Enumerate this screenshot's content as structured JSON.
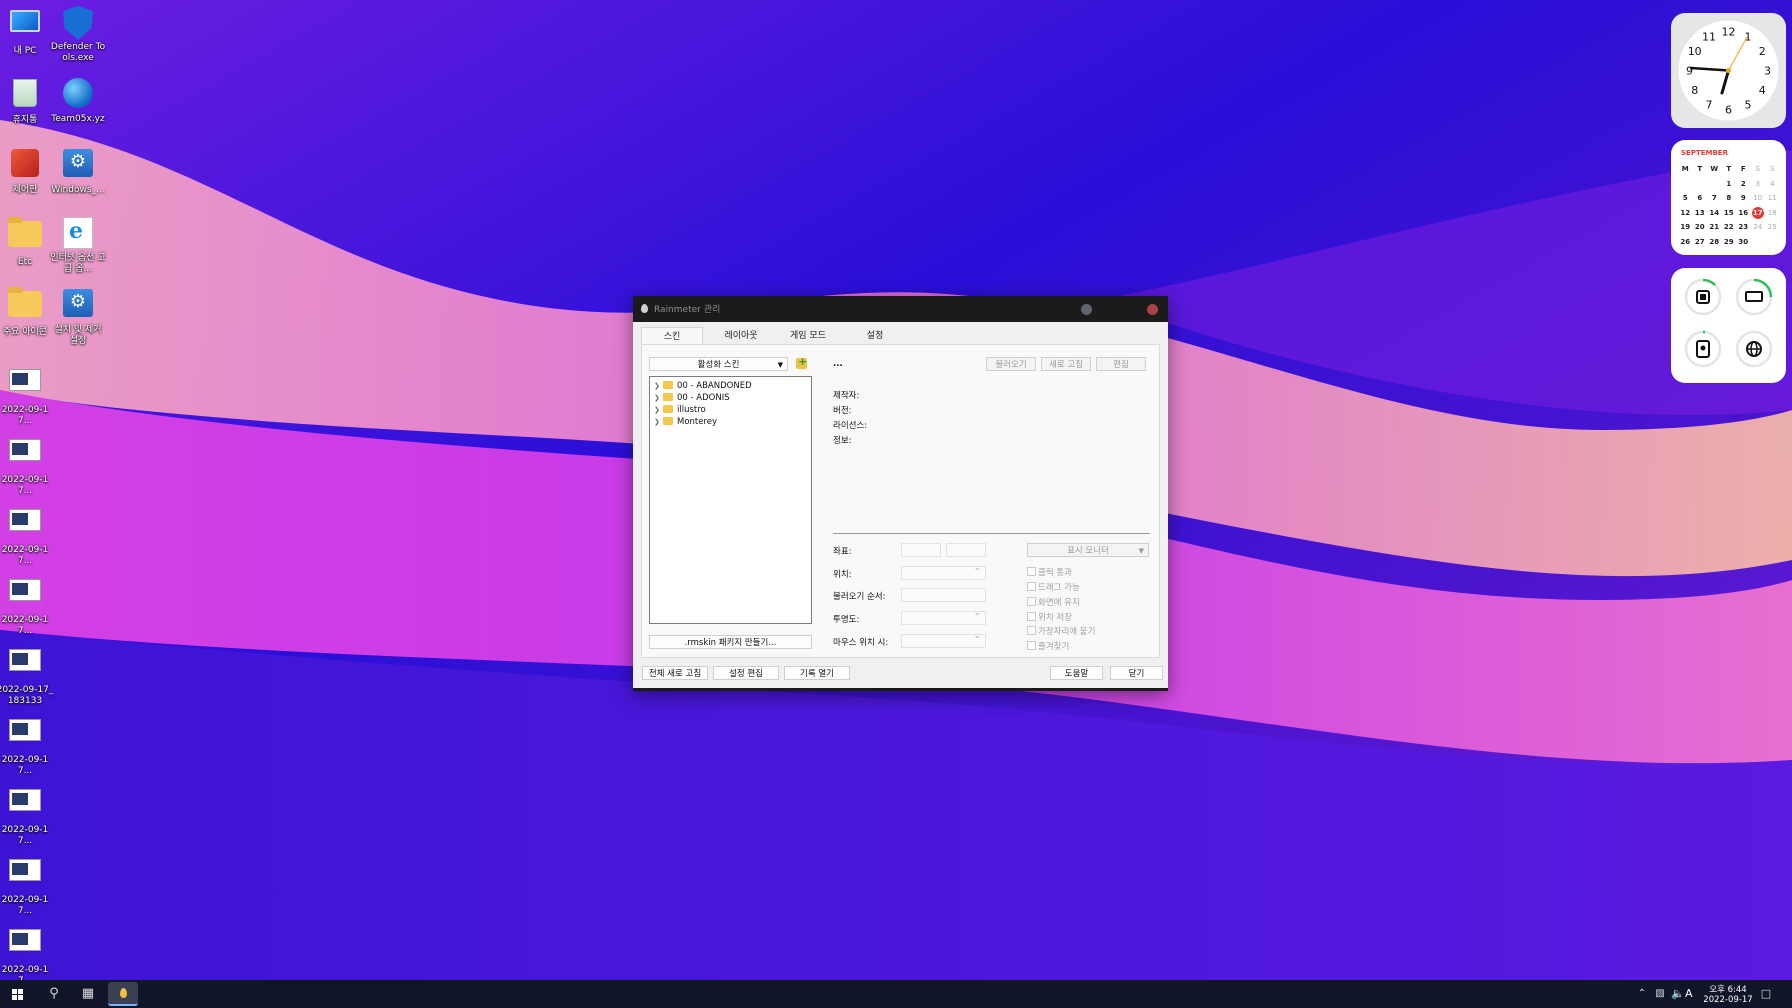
{
  "desktop": {
    "icons": [
      {
        "label": "내 PC"
      },
      {
        "label": "Defender Tools.exe"
      },
      {
        "label": "휴지통"
      },
      {
        "label": "Team05x.yz"
      },
      {
        "label": "제어판"
      },
      {
        "label": "Windows_..."
      },
      {
        "label": "Etc"
      },
      {
        "label": "인터넷 옵션 고급 옵..."
      },
      {
        "label": "주요 아이콘"
      },
      {
        "label": "설치 및 제거 설정"
      },
      {
        "label": "2022-09-17..."
      },
      {
        "label": "2022-09-17..."
      },
      {
        "label": "2022-09-17..."
      },
      {
        "label": "2022-09-17..."
      },
      {
        "label": "2022-09-17_183133"
      },
      {
        "label": "2022-09-17..."
      },
      {
        "label": "2022-09-17..."
      },
      {
        "label": "2022-09-17..."
      },
      {
        "label": "2022-09-17..."
      }
    ]
  },
  "clock_widget": {
    "numerals": [
      "12",
      "1",
      "2",
      "3",
      "4",
      "5",
      "6",
      "7",
      "8",
      "9",
      "10",
      "11"
    ]
  },
  "calendar_widget": {
    "month": "SEPTEMBER",
    "weekdays": [
      "M",
      "T",
      "W",
      "T",
      "F",
      "S",
      "S"
    ],
    "weeks": [
      [
        "",
        "",
        "",
        "1",
        "2",
        "3",
        "4"
      ],
      [
        "5",
        "6",
        "7",
        "8",
        "9",
        "10",
        "11"
      ],
      [
        "12",
        "13",
        "14",
        "15",
        "16",
        "17",
        "18"
      ],
      [
        "19",
        "20",
        "21",
        "22",
        "23",
        "24",
        "25"
      ],
      [
        "26",
        "27",
        "28",
        "29",
        "30",
        "",
        ""
      ]
    ],
    "today": "17"
  },
  "rainmeter": {
    "title": "Rainmeter 관리",
    "tabs": [
      "스킨",
      "레이아웃",
      "게임 모드",
      "설정"
    ],
    "active_skins_dropdown": "활성화 스킨",
    "skin_name": "...",
    "buttons_top": {
      "load": "불러오기",
      "refresh": "새로 고침",
      "edit": "편집"
    },
    "info_labels": {
      "author": "제작자:",
      "version": "버전:",
      "license": "라이선스:",
      "info": "정보:"
    },
    "tree": [
      "00 - ABANDONED",
      "00 - ADONIS",
      "illustro",
      "Monterey"
    ],
    "rmskin_button": ".rmskin 패키지 만들기...",
    "props": {
      "coords": "좌표:",
      "position": "위치:",
      "load_order": "불러오기 순서:",
      "transparency": "투명도:",
      "on_hover": "마우스 위치 시:"
    },
    "display_monitor": "표시 모니터",
    "checkboxes": [
      "클릭 통과",
      "드래그 가능",
      "화면에 유지",
      "위치 저장",
      "가장자리에 붙기",
      "즐겨찾기"
    ],
    "bottom": {
      "refresh_all": "전체 새로 고침",
      "edit_settings": "설정 편집",
      "open_log": "기록 열기",
      "help": "도움말",
      "close": "닫기"
    }
  },
  "taskbar": {
    "tray_time": "오후 6:44",
    "tray_date": "2022-09-17",
    "ime": "A"
  },
  "colors": {
    "accent_red": "#e53935",
    "taskbar": "#101529",
    "titlebar": "#1b1b1b"
  }
}
